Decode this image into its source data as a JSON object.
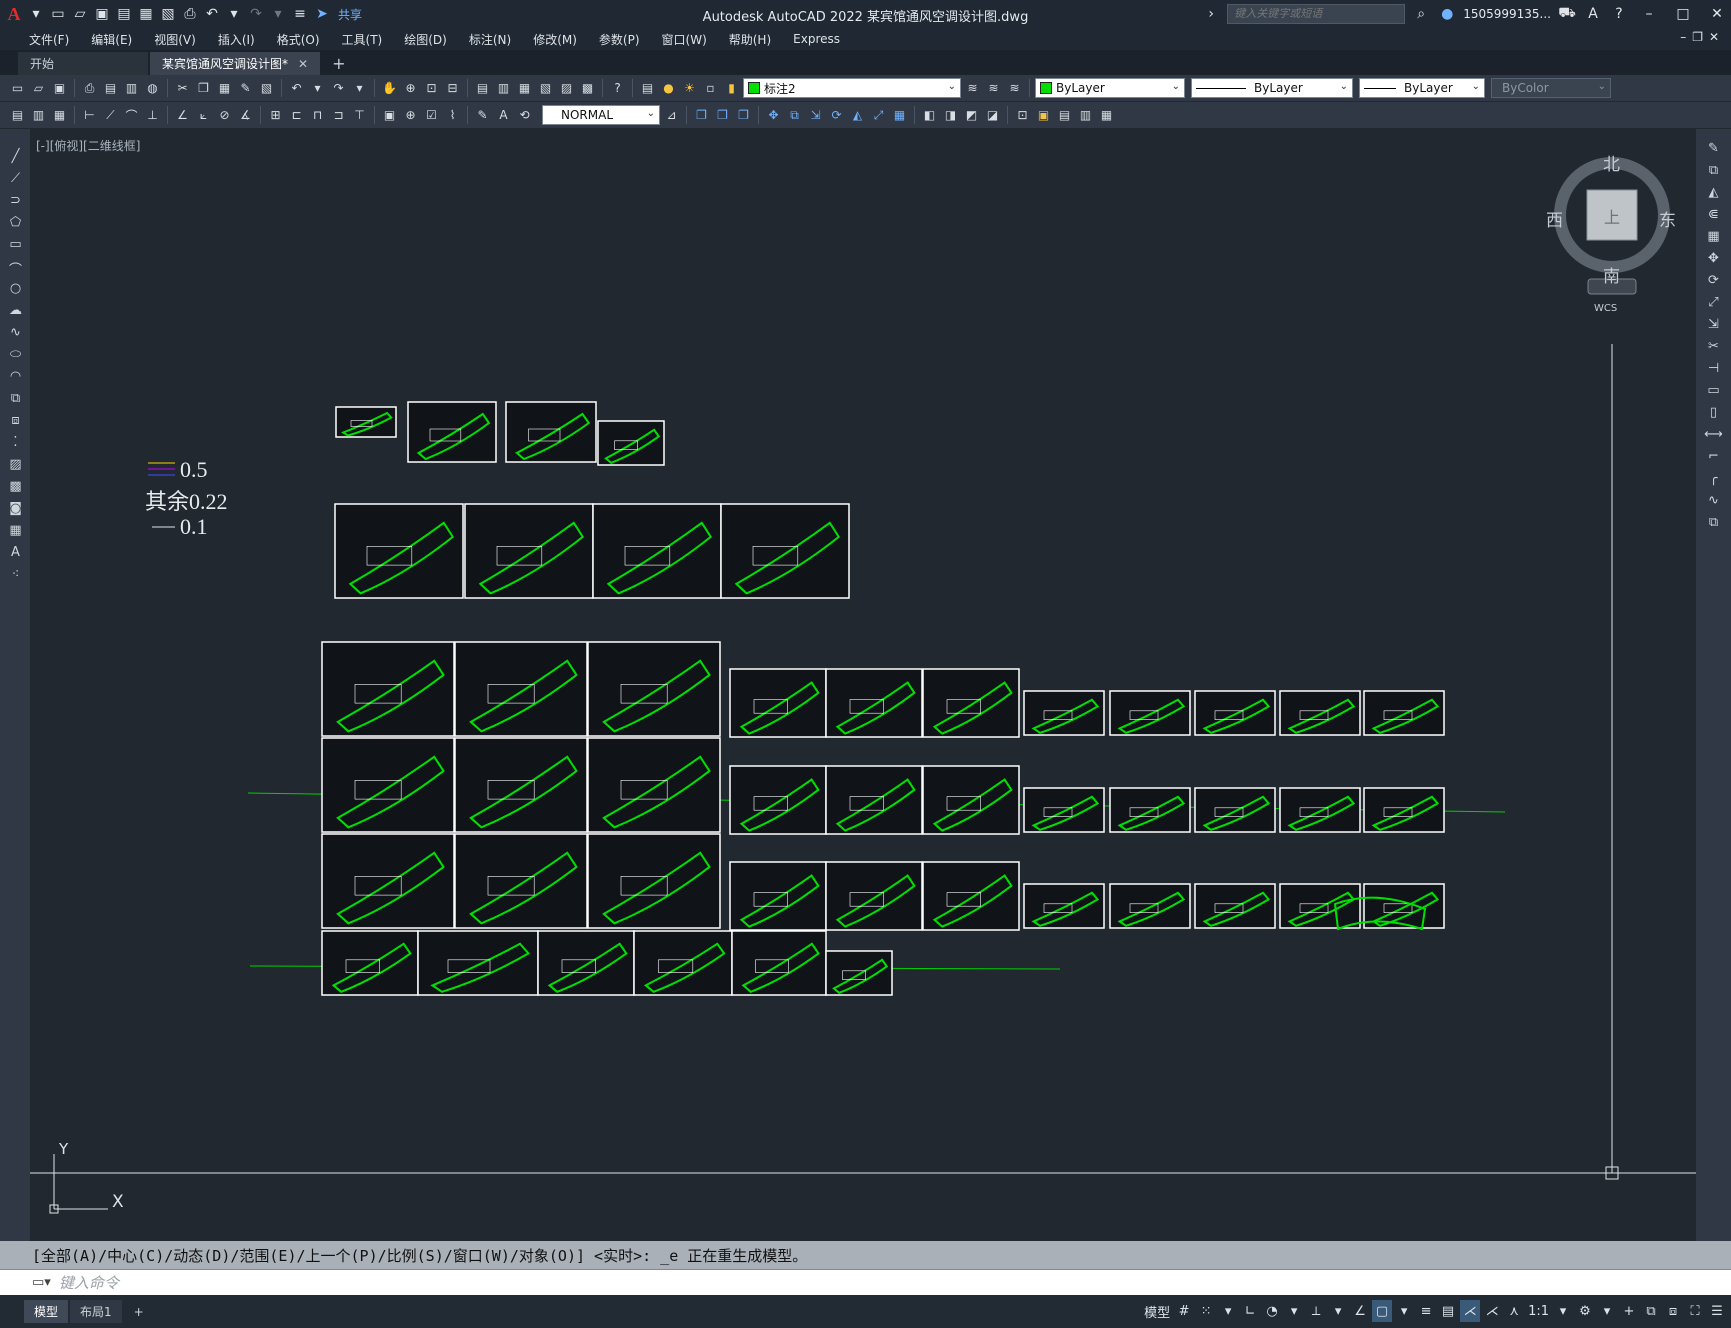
{
  "app": {
    "title": "Autodesk AutoCAD 2022    某宾馆通风空调设计图.dwg",
    "share_label": "共享",
    "search_placeholder": "键入关键字或短语",
    "user": "1505999135...",
    "logo": "A"
  },
  "menu": [
    "文件(F)",
    "编辑(E)",
    "视图(V)",
    "插入(I)",
    "格式(O)",
    "工具(T)",
    "绘图(D)",
    "标注(N)",
    "修改(M)",
    "参数(P)",
    "窗口(W)",
    "帮助(H)",
    "Express"
  ],
  "tabs": {
    "start": "开始",
    "active": "某宾馆通风空调设计图*",
    "close": "✕",
    "add": "+"
  },
  "properties": {
    "layer": "标注2",
    "color": "ByLayer",
    "linetype": "ByLayer",
    "lineweight": "ByLayer",
    "plotstyle": "ByColor",
    "dimstyle": "NORMAL"
  },
  "viewport": {
    "label": "[-][俯视][二维线框]",
    "compass": {
      "north": "北",
      "south": "南",
      "east": "东",
      "west": "西",
      "center": "上"
    },
    "wcs": "WCS",
    "ucs_x": "X",
    "ucs_y": "Y",
    "legend": {
      "l1": "0.5",
      "l2": "其余0.22",
      "l3": "0.1"
    }
  },
  "command": {
    "history": "[全部(A)/中心(C)/动态(D)/范围(E)/上一个(P)/比例(S)/窗口(W)/对象(O)] <实时>: _e 正在重生成模型。",
    "placeholder": "键入命令"
  },
  "status": {
    "tabs": [
      "模型",
      "布局1"
    ],
    "add": "+",
    "model_label": "模型",
    "scale": "1:1"
  },
  "colors": {
    "accent": "#00e000",
    "background": "#212830",
    "sheet_border": "#ffffff",
    "axis_line": "#ffffff"
  }
}
